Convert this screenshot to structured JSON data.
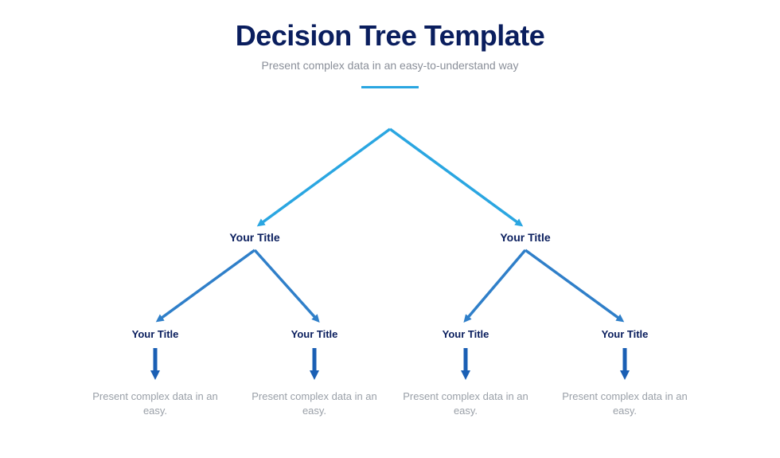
{
  "header": {
    "title": "Decision Tree Template",
    "subtitle": "Present complex data in an easy-to-understand way"
  },
  "colors": {
    "dark_navy": "#0a1e5e",
    "light_blue": "#2aa6e1",
    "mid_blue": "#2f7fc9",
    "deep_blue": "#1a5fb4",
    "gray": "#9aa0a8"
  },
  "tree": {
    "mid_left": "Your Title",
    "mid_right": "Your Title",
    "leaf1": "Your Title",
    "leaf2": "Your Title",
    "leaf3": "Your Title",
    "leaf4": "Your Title",
    "desc1": "Present complex data in an easy.",
    "desc2": "Present complex data in an easy.",
    "desc3": "Present complex data in an easy.",
    "desc4": "Present complex data in an easy."
  }
}
